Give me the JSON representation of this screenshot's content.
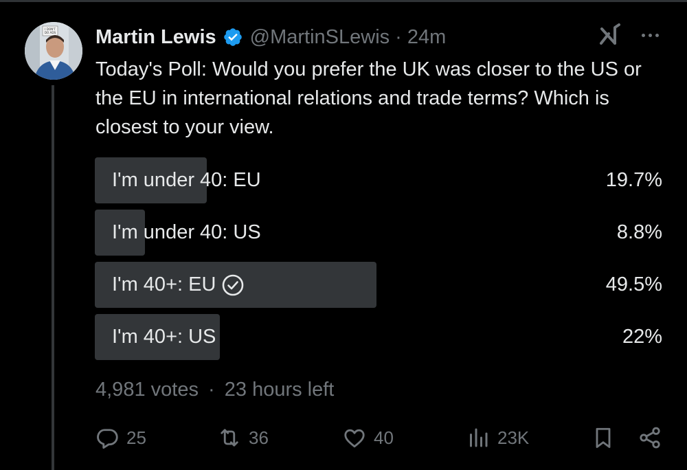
{
  "post": {
    "author": {
      "name": "Martin Lewis",
      "handle": "@MartinSLewis",
      "separator": "·",
      "time": "24m",
      "verified": true,
      "avatar_sign_text": "I DON'T DO ADS"
    },
    "text": "Today's Poll: Would you prefer the UK was closer to the US or the EU in international relations and trade terms? Which is closest to your view.",
    "poll": {
      "options": [
        {
          "label": "I'm under 40: EU",
          "percent_text": "19.7%",
          "percent": 19.7,
          "winner": false
        },
        {
          "label": "I'm under 40: US",
          "percent_text": "8.8%",
          "percent": 8.8,
          "winner": false
        },
        {
          "label": "I'm 40+: EU",
          "percent_text": "49.5%",
          "percent": 49.5,
          "winner": true
        },
        {
          "label": "I'm 40+: US",
          "percent_text": "22%",
          "percent": 22,
          "winner": false
        }
      ],
      "votes": "4,981 votes",
      "separator": "·",
      "time_left": "23 hours left"
    },
    "actions": {
      "replies": "25",
      "reposts": "36",
      "likes": "40",
      "views": "23K"
    }
  },
  "colors": {
    "background": "#000000",
    "text_primary": "#e7e9ea",
    "text_secondary": "#71767b",
    "poll_bar": "#333639",
    "verified_badge": "#1d9bf0"
  },
  "icons": [
    "verified-badge-icon",
    "grok-icon",
    "more-icon",
    "check-circle-icon",
    "reply-icon",
    "repost-icon",
    "like-icon",
    "views-icon",
    "bookmark-icon",
    "share-icon"
  ]
}
